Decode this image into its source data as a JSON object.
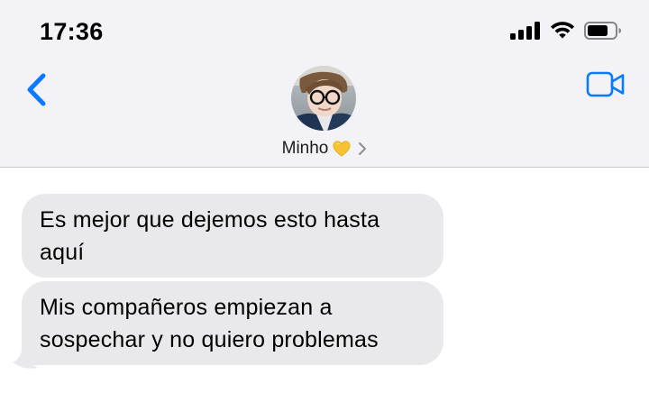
{
  "status_bar": {
    "time": "17:36",
    "icons": [
      "cellular-signal-icon",
      "wifi-icon",
      "battery-icon"
    ]
  },
  "nav": {
    "back_icon": "chevron-left-icon",
    "video_icon": "video-camera-icon",
    "accent_color": "#0a7aff"
  },
  "contact": {
    "name": "Minho",
    "emoji": "yellow-heart-icon",
    "disclosure_icon": "chevron-right-icon"
  },
  "messages": [
    {
      "direction": "incoming",
      "lines": [
        "Es mejor que dejemos esto hasta",
        "aquí"
      ]
    },
    {
      "direction": "incoming",
      "lines": [
        "Mis compañeros empiezan a",
        "sospechar y no quiero problemas"
      ]
    }
  ],
  "colors": {
    "header_bg": "#f2f2f7",
    "incoming_bubble": "#e9e9eb"
  }
}
